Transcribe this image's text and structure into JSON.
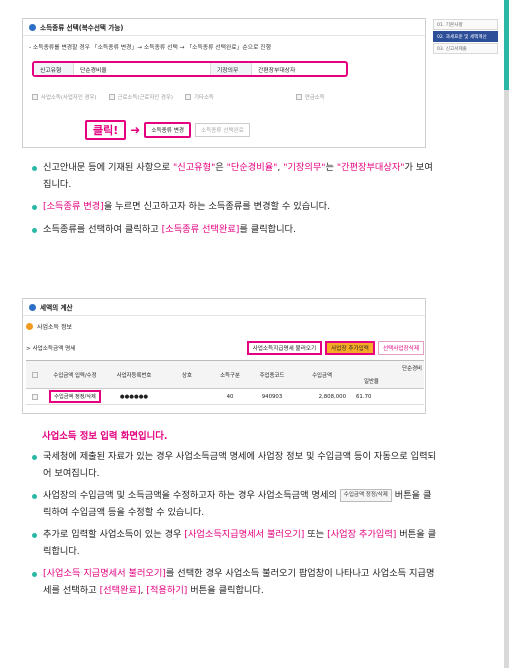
{
  "section1": {
    "title": "소득종류 선택(복수선택 가능)",
    "note": "- 소득종류를 변경할 경우 「소득종류 변경」→ 소득종류 선택 → 「소득종류 선택완료」순으로 진행",
    "row": {
      "type_label": "신고유형",
      "type_value": "단순경비율",
      "duty_label": "기장의무",
      "duty_value": "간편장부대상자"
    },
    "checkboxes": [
      "사업소득(사업자인 경우)",
      "근로소득(근로자인 경우)",
      "기타소득",
      "연금소득"
    ],
    "click_label": "클릭!",
    "arrow": "➜",
    "change_button": "소득종류 변경",
    "complete_button": "소득종류 선택완료"
  },
  "steps": [
    "01. 기본사항",
    "02. 과세표준 및 세액계산",
    "03. 신고서제출"
  ],
  "bullets_top": [
    [
      "신고안내문 등에 기재된 사항으로 ",
      "\"신고유형\"",
      "은 ",
      "\"단순경비율\"",
      ", ",
      "\"기장의무\"",
      "는 ",
      "\"간편장부대상자\"",
      "가 보여집니다."
    ],
    [
      "",
      "[소득종류 변경]",
      "을 누르면 신고하고자 하는 소득종류를 변경할 수 있습니다."
    ],
    [
      "소득종류를 선택하여 클릭하고 ",
      "[소득종류 선택완료]",
      "를 클릭합니다."
    ]
  ],
  "section2": {
    "title": "세액의 계산",
    "sub_title": "사업소득 정보",
    "list_label": "> 사업소득금액 명세",
    "btn_load": "사업소득지급명세 불러오기",
    "btn_add": "사업장 추가입력",
    "btn_delete": "선택사업장삭제",
    "headers": [
      "수입금액 입력/수정",
      "사업자등록번호",
      "상호",
      "소득구분",
      "주업종코드",
      "수입금액",
      "단순경비",
      "일반율"
    ],
    "row": {
      "edit_button": "수입금액 정정/삭제",
      "biz_no": "●●●●●●",
      "name": "",
      "income_type": "40",
      "industry_code": "940903",
      "revenue": "2,808,000",
      "rate": "61.70"
    }
  },
  "caption": "사업소득 정보 입력 화면입니다.",
  "bullets_bottom": [
    [
      "국세청에 제출된 자료가 있는 경우 사업소득금액 명세에 사업장 정보 및 수입금액 등이 자동으로 입력되어 보여집니다."
    ],
    [
      "사업장의 수입금액 및 소득금액을 수정하고자 하는 경우 사업소득금액 명세의 ",
      "@수입금액 정정/삭제",
      " 버튼을 클릭하여 수입금액 등을 수정할 수 있습니다."
    ],
    [
      "추가로 입력할 사업소득이 있는 경우 ",
      "[사업소득지급명세서 불러오기]",
      " 또는 ",
      "[사업장 추가입력]",
      " 버튼을 클릭합니다."
    ],
    [
      "",
      "[사업소득 지급명세서 불러오기]",
      "를 선택한 경우 사업소득 불러오기 팝업창이 나타나고 사업소득 지급명세를 선택하고 ",
      "[선택완료]",
      ", ",
      "[적용하기]",
      " 버튼을 클릭합니다."
    ]
  ]
}
